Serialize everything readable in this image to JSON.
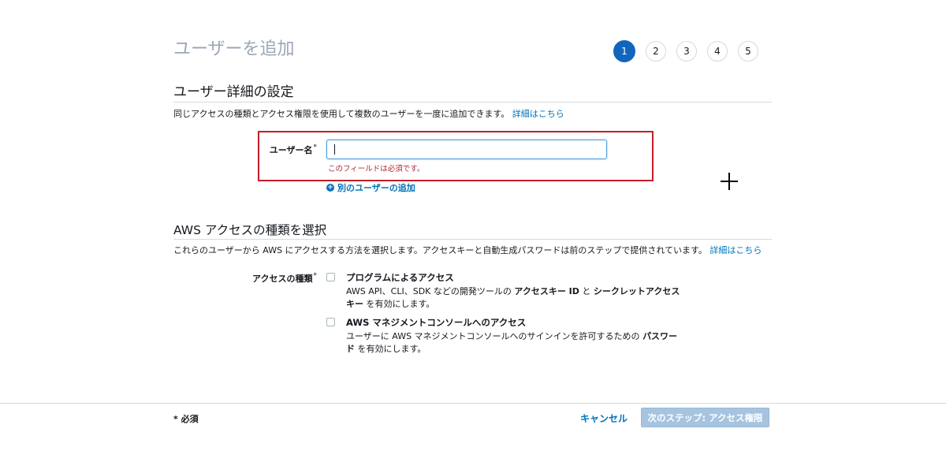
{
  "page": {
    "title": "ユーザーを追加"
  },
  "steps": [
    {
      "label": "1",
      "active": true
    },
    {
      "label": "2",
      "active": false
    },
    {
      "label": "3",
      "active": false
    },
    {
      "label": "4",
      "active": false
    },
    {
      "label": "5",
      "active": false
    }
  ],
  "user_details": {
    "title": "ユーザー詳細の設定",
    "description": "同じアクセスの種類とアクセス権限を使用して複数のユーザーを一度に追加できます。",
    "learn_more": "詳細はこちら",
    "username_label": "ユーザー名",
    "required_mark": "*",
    "username_value": "",
    "error": "このフィールドは必須です。",
    "add_another": "別のユーザーの追加"
  },
  "access_type": {
    "title": "AWS アクセスの種類を選択",
    "description": "これらのユーザーから AWS にアクセスする方法を選択します。アクセスキーと自動生成パスワードは前のステップで提供されています。",
    "learn_more": "詳細はこちら",
    "label": "アクセスの種類",
    "required_mark": "*",
    "options": [
      {
        "title": "プログラムによるアクセス",
        "line1_pre": "AWS API、CLI、SDK などの開発ツールの ",
        "line1_b1": "アクセスキー ID",
        "line1_mid": " と ",
        "line1_b2": "シークレットアクセス",
        "line2_b": "キー",
        "line2_post": " を有効にします。",
        "checked": false
      },
      {
        "title": "AWS マネジメントコンソールへのアクセス",
        "line1_pre": "ユーザーに AWS マネジメントコンソールへのサインインを許可するための ",
        "line1_b": "パスワー",
        "line2_b": "ド",
        "line2_post": " を有効にします。",
        "checked": false
      }
    ]
  },
  "footer": {
    "required_note": "* 必須",
    "cancel": "キャンセル",
    "next": "次のステップ: アクセス権限"
  },
  "colors": {
    "accent": "#1166bb",
    "link": "#0073bb",
    "error": "#b0272e",
    "highlight_box": "#c21e2a",
    "disabled_button": "#a6c4e0"
  }
}
